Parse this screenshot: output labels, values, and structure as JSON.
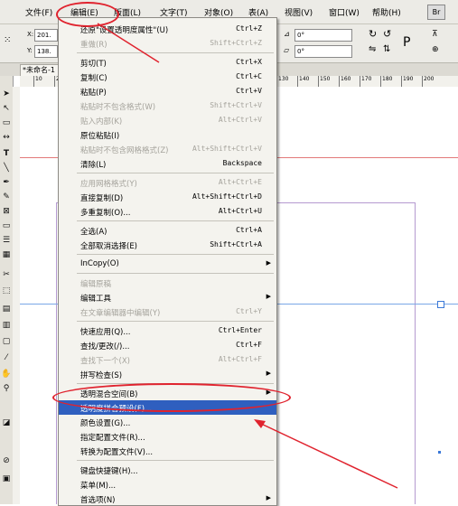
{
  "menubar": {
    "items": [
      "文件(F)",
      "编辑(E)",
      "版面(L)",
      "文字(T)",
      "对象(O)",
      "表(A)",
      "视图(V)",
      "窗口(W)",
      "帮助(H)"
    ],
    "br_label": "Br"
  },
  "control_bar": {
    "x_label": "X:",
    "x_value": "201.",
    "y_label": "Y:",
    "y_value": "138.",
    "rotate_value": "0°",
    "shear_value": "0°"
  },
  "document": {
    "tab_title": "*未命名-1"
  },
  "ruler": {
    "ticks": [
      "10",
      "20",
      "130",
      "140",
      "150",
      "160",
      "170",
      "180",
      "190",
      "200"
    ]
  },
  "edit_menu": {
    "items": [
      {
        "label": "还原\"设置透明度属性\"(U)",
        "shortcut": "Ctrl+Z",
        "enabled": true
      },
      {
        "label": "重做(R)",
        "shortcut": "Shift+Ctrl+Z",
        "enabled": false
      },
      {
        "label": "剪切(T)",
        "shortcut": "Ctrl+X",
        "enabled": true
      },
      {
        "label": "复制(C)",
        "shortcut": "Ctrl+C",
        "enabled": true
      },
      {
        "label": "粘贴(P)",
        "shortcut": "Ctrl+V",
        "enabled": true
      },
      {
        "label": "粘贴时不包含格式(W)",
        "shortcut": "Shift+Ctrl+V",
        "enabled": false
      },
      {
        "label": "贴入内部(K)",
        "shortcut": "Alt+Ctrl+V",
        "enabled": false
      },
      {
        "label": "原位粘贴(I)",
        "shortcut": "",
        "enabled": true
      },
      {
        "label": "粘贴时不包含网格格式(Z)",
        "shortcut": "Alt+Shift+Ctrl+V",
        "enabled": false
      },
      {
        "label": "清除(L)",
        "shortcut": "Backspace",
        "enabled": true
      },
      {
        "label": "应用网格格式(Y)",
        "shortcut": "Alt+Ctrl+E",
        "enabled": false
      },
      {
        "label": "直接复制(D)",
        "shortcut": "Alt+Shift+Ctrl+D",
        "enabled": true
      },
      {
        "label": "多重复制(O)...",
        "shortcut": "Alt+Ctrl+U",
        "enabled": true
      },
      {
        "label": "全选(A)",
        "shortcut": "Ctrl+A",
        "enabled": true
      },
      {
        "label": "全部取消选择(E)",
        "shortcut": "Shift+Ctrl+A",
        "enabled": true
      },
      {
        "label": "InCopy(O)",
        "shortcut": "",
        "enabled": true
      },
      {
        "label": "编辑原稿",
        "shortcut": "",
        "enabled": false
      },
      {
        "label": "编辑工具",
        "shortcut": "",
        "enabled": true
      },
      {
        "label": "在文章编辑器中编辑(Y)",
        "shortcut": "Ctrl+Y",
        "enabled": false
      },
      {
        "label": "快速应用(Q)...",
        "shortcut": "Ctrl+Enter",
        "enabled": true
      },
      {
        "label": "查找/更改(/)...",
        "shortcut": "Ctrl+F",
        "enabled": true
      },
      {
        "label": "查找下一个(X)",
        "shortcut": "Alt+Ctrl+F",
        "enabled": false
      },
      {
        "label": "拼写检查(S)",
        "shortcut": "",
        "enabled": true
      },
      {
        "label": "透明混合空间(B)",
        "shortcut": "",
        "enabled": true
      },
      {
        "label": "透明度拼合预设(F)...",
        "shortcut": "",
        "enabled": true
      },
      {
        "label": "颜色设置(G)...",
        "shortcut": "",
        "enabled": true
      },
      {
        "label": "指定配置文件(R)...",
        "shortcut": "",
        "enabled": true
      },
      {
        "label": "转换为配置文件(V)...",
        "shortcut": "",
        "enabled": true
      },
      {
        "label": "键盘快捷键(H)...",
        "shortcut": "",
        "enabled": true
      },
      {
        "label": "菜单(M)...",
        "shortcut": "",
        "enabled": true
      },
      {
        "label": "首选项(N)",
        "shortcut": "",
        "enabled": true
      }
    ]
  },
  "colors": {
    "highlight": "#2f5fbf",
    "annotation": "#e0232e",
    "disabled_text": "#a5a39c"
  }
}
